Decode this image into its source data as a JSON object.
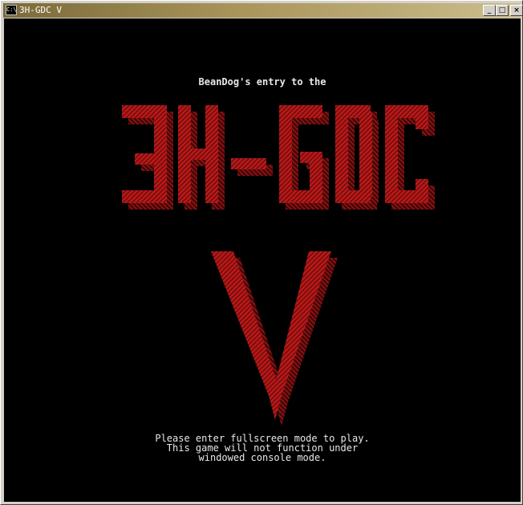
{
  "window": {
    "title": "3H-GDC V",
    "icon_label": "C:\\",
    "icon": "console-icon",
    "buttons": {
      "minimize": "_",
      "maximize": "□",
      "close": "×"
    }
  },
  "console": {
    "intro": "BeanDog's entry to the",
    "banner_line1": "3H-GDC",
    "banner_line2": "V",
    "message_lines": [
      "Please enter fullscreen mode to play.",
      "This game will not function under",
      "windowed console mode."
    ],
    "colors": {
      "background": "#000000",
      "text": "#e8e8e8",
      "banner_red": "#c21a1a",
      "banner_dark_red": "#7a0e0e"
    }
  }
}
